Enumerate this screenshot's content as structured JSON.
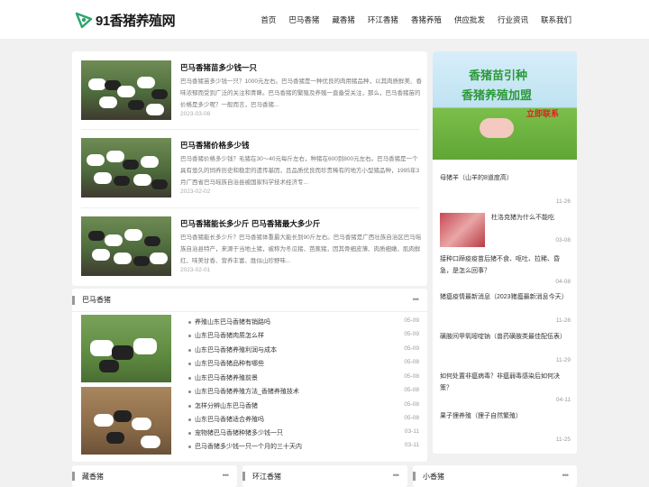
{
  "header": {
    "logo_text": "91香猪养殖网",
    "nav": [
      "首页",
      "巴马香猪",
      "藏香猪",
      "环江香猪",
      "香猪养殖",
      "供应批发",
      "行业资讯",
      "联系我们"
    ]
  },
  "articles": [
    {
      "title": "巴马香猪苗多少钱一只",
      "desc": "巴马香猪苗多少钱一只？1000元左右。巴马香猪是一种优良的肉用猪品种，以其肉质鲜美、香味浓郁而受到广泛的关注和青睐。巴马香猪的繁殖及养殖一直备受关注，那么，巴马香猪苗的价格是多少呢？一般而言，巴马香猪...",
      "date": "2023-03-08"
    },
    {
      "title": "巴马香猪价格多少钱",
      "desc": "巴马香猪价格多少钱？毛猪在30～40元每斤左右，种猪在600到800元左右。巴马香猪是一个具有悠久的饲养历史和稳定的遗传基因，且品质优良而珍贵稀有的地方小型猪品种，1995年3月广西省巴马瑶族自治县被国家科学技术经济专...",
      "date": "2023-02-02"
    },
    {
      "title": "巴马香猪能长多少斤 巴马香猪最大多少斤",
      "desc": "巴马香猪能长多少斤？巴马香猪体重最大能长到90斤左右。巴马香猪是广西壮族自治区巴马瑶族自治县特产，来源于当地土猪，被称为冬瓜猪、芭蕉猪，因其骨细皮薄、肉质细嫩、肌肉鲜红、味美甘香、营养丰富、胜似山珍野味...",
      "date": "2023-02-01"
    }
  ],
  "bama": {
    "title": "巴马香猪",
    "more": "•••",
    "items": [
      {
        "t": "养殖山东巴马香猪有销路吗",
        "d": "05-09"
      },
      {
        "t": "山东巴马香猪肉质怎么样",
        "d": "05-09"
      },
      {
        "t": "山东巴马香猪养殖利润与成本",
        "d": "05-09"
      },
      {
        "t": "山东巴马香猪品种有哪些",
        "d": "05-08"
      },
      {
        "t": "山东巴马香猪养殖前景",
        "d": "05-08"
      },
      {
        "t": "山东巴马香猪养殖方法_香猪养殖技术",
        "d": "05-08"
      },
      {
        "t": "怎样分辨山东巴马香猪",
        "d": "05-08"
      },
      {
        "t": "山东巴马香猪适合养殖吗",
        "d": "05-08"
      },
      {
        "t": "宠物猪巴马香猪种猪多少钱一只",
        "d": "03-11"
      },
      {
        "t": "巴马香猪多少钱一只一个月的三十天内",
        "d": "03-11"
      }
    ]
  },
  "banner": {
    "line1": "香猪苗引种",
    "line2": "香猪养殖加盟",
    "line3": "立即联系"
  },
  "side": [
    {
      "t": "母猪羊（山羊的8道度高）",
      "d": "11-26"
    },
    {
      "t": "杜洛克猪为什么不能吃",
      "d": "03-08"
    },
    {
      "t": "接种口蹄疫疫苗后猪不食、呕吐、拉稀、昏急，是怎么回事？",
      "d": "04-08"
    },
    {
      "t": "猪瘟疫情最新消息（2023猪瘟最新消息今天）",
      "d": "11-28"
    },
    {
      "t": "磺胺间甲氧嘧啶钠（兽药磺胺类最佳配伍表）",
      "d": "11-29"
    },
    {
      "t": "如何处置非瘟病毒？非瘟弱毒感染后如何决策？",
      "d": "04-11"
    },
    {
      "t": "果子狸养殖（狸子自然繁殖）",
      "d": "11-25"
    }
  ],
  "bottom": [
    {
      "title": "藏香猪",
      "more": "•••"
    },
    {
      "title": "环江香猪",
      "more": "•••"
    },
    {
      "title": "小香猪",
      "more": "•••"
    }
  ]
}
